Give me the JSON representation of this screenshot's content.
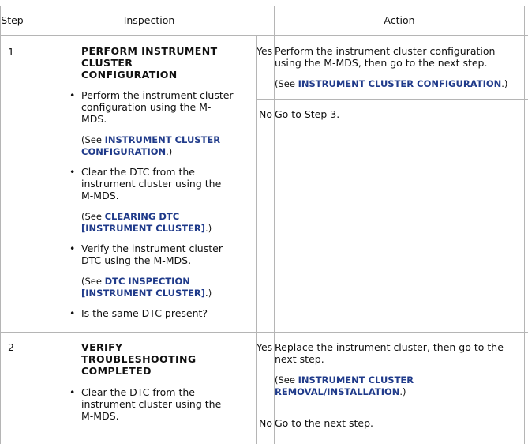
{
  "header": {
    "step": "Step",
    "inspection": "Inspection",
    "action": "Action"
  },
  "rows": [
    {
      "step": "1",
      "title": "PERFORM INSTRUMENT CLUSTER CONFIGURATION",
      "bullets": [
        {
          "text": "Perform the instrument cluster configuration using the M-MDS.",
          "ref_pre": "(See ",
          "ref_link": "INSTRUMENT CLUSTER CONFIGURATION",
          "ref_post": ".)"
        },
        {
          "text": "Clear the DTC from the instrument cluster using the M-MDS.",
          "ref_pre": "(See ",
          "ref_link": "CLEARING DTC [INSTRUMENT CLUSTER]",
          "ref_post": ".)"
        },
        {
          "text": "Verify the instrument cluster DTC using the M-MDS.",
          "ref_pre": "(See ",
          "ref_link": "DTC INSPECTION [INSTRUMENT CLUSTER]",
          "ref_post": ".)"
        },
        {
          "text": "Is the same DTC present?"
        }
      ],
      "yes": {
        "label": "Yes",
        "text": "Perform the instrument cluster configuration using the M-MDS, then go to the next step.",
        "ref_pre": "(See ",
        "ref_link": "INSTRUMENT CLUSTER CONFIGURATION",
        "ref_post": ".)"
      },
      "no": {
        "label": "No",
        "text": "Go to Step 3."
      }
    },
    {
      "step": "2",
      "title": "VERIFY TROUBLESHOOTING COMPLETED",
      "bullets": [
        {
          "text": "Clear the DTC from the instrument cluster using the M-MDS."
        }
      ],
      "yes": {
        "label": "Yes",
        "text": "Replace the instrument cluster, then go to the next step.",
        "ref_pre": "(See ",
        "ref_link": "INSTRUMENT CLUSTER REMOVAL/INSTALLATION",
        "ref_post": ".)"
      },
      "no": {
        "label": "No",
        "text": "Go to the next step."
      }
    }
  ]
}
